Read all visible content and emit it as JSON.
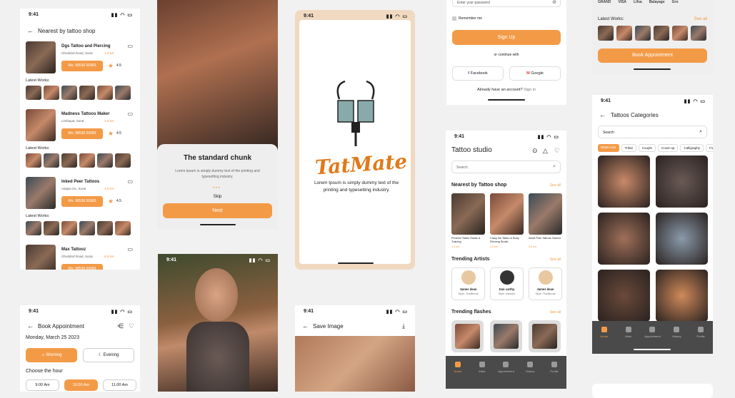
{
  "status_time": "9:41",
  "nearest": {
    "title": "Nearest by tattoo shop",
    "latest": "Latest Works:",
    "call": "Mo. 98536 56983",
    "shops": [
      {
        "name": "Dgs Tattoo and Piercing",
        "addr": "Ghoddod Road, Surat",
        "dist": "1.5 km",
        "rating": "4.5"
      },
      {
        "name": "Madness Tattoos Maker",
        "addr": "Limbayat, Surat",
        "dist": "3.5 km",
        "rating": "4.5"
      },
      {
        "name": "Inked Peer Tattoos",
        "addr": "Adajan Dn, Surat",
        "dist": "4.5 km",
        "rating": "4.5"
      },
      {
        "name": "Max Tattooz",
        "addr": "Ghoddod Road, Surat",
        "dist": "8.5 km",
        "rating": ""
      }
    ]
  },
  "onboard": {
    "title": "The standard chunk",
    "body": "Lorem Ipsum is simply dummy text of the printing and typesetting industry.",
    "skip": "Skip",
    "next": "Next"
  },
  "splash": {
    "logo": "TatMate",
    "body": "Lorem Ipsum is simply dummy text of the printing and typesetting industry."
  },
  "login": {
    "password_placeholder": "Enter your password",
    "remember": "Remember me",
    "signup": "Sign Up",
    "or": "or continue with",
    "facebook": "Facebook",
    "google": "Google",
    "account": "Already have an account?",
    "signin": "Sign in"
  },
  "studio": {
    "title": "Tattoo studio",
    "search": "Search",
    "nearest": "Nearest by Tattoo shop",
    "seeall": "See all",
    "shops": [
      {
        "name": "Phoenix Tattoo Studio & Training",
        "dist": "1.5 km"
      },
      {
        "name": "Crazy Ink Tattoo & Body Piercing Studio",
        "dist": "2.5 km"
      },
      {
        "name": "Inked Peer Tattoos Owned",
        "dist": "3.5 km"
      }
    ],
    "trending_artists": "Trending Artists",
    "artists": [
      {
        "name": "James dean",
        "style": "Style: Traditional"
      },
      {
        "name": "Dan carthy",
        "style": "Style: dotwork"
      },
      {
        "name": "James dean",
        "style": "Style: Traditional"
      }
    ],
    "trending_flashes": "Trending flashes"
  },
  "nav": [
    "Home",
    "Artist",
    "Appointment",
    "History",
    "Profile"
  ],
  "artist": {
    "brands": [
      "GRAND",
      "VISA",
      "Lifsa",
      "Balayage",
      "Gro"
    ],
    "latest": "Latest Works:",
    "seeall": "See all",
    "book": "Book Appointment"
  },
  "categories": {
    "title": "Tattoos Categories",
    "search": "Search",
    "chips": [
      "Watercolor",
      "Tribal",
      "Couple",
      "Cover-up",
      "Calligraphy",
      "Fu"
    ]
  },
  "book": {
    "title": "Book Appointment",
    "date": "Monday, March 25 2023",
    "morning": "Morning",
    "evening": "Evening",
    "choose": "Choose the hour",
    "times": [
      "9:00 Am",
      "10:00 Am",
      "11:00 Am"
    ]
  },
  "save": {
    "title": "Save Image"
  }
}
